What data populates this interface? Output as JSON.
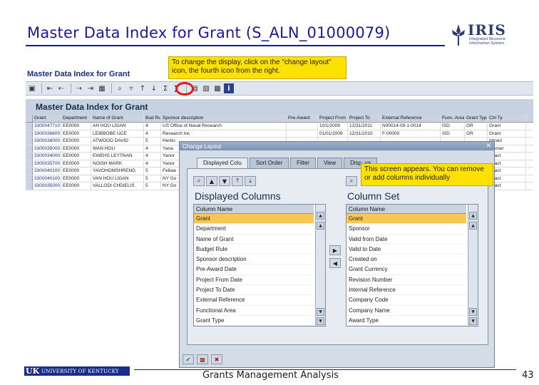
{
  "slide": {
    "title": "Master Data Index for Grant (S_ALN_01000079)",
    "footer_center": "Grants Management Analysis",
    "page_number": "43"
  },
  "logo": {
    "word": "IRIS",
    "sub": "Integrated Resource Information System"
  },
  "uk_logo": {
    "abbr": "UK",
    "name": "UNIVERSITY OF KENTUCKY"
  },
  "sap": {
    "window_title": "Master Data Index for Grant",
    "grid_title": "Master Data Index for Grant",
    "toolbar_icons": [
      "print-icon",
      "first-page-icon",
      "prev-page-icon",
      "next-page-icon",
      "last-page-icon",
      "filter-icon",
      "sort-asc-icon",
      "sort-desc-icon",
      "sum-icon",
      "subtotal-icon",
      "change-layout-icon",
      "select-layout-icon",
      "save-layout-icon",
      "info-icon"
    ]
  },
  "callouts": {
    "change_layout": "To change the display, click on the \"change layout\" icon, the fourth icon from the right.",
    "screen_appears": "This screen appears. You can remove or add columns individually"
  },
  "grid": {
    "columns": [
      "Grant",
      "Department",
      "Name of Grant",
      "Bud Rule",
      "Sponsor description",
      "Pre-Award",
      "Project From",
      "Project To",
      "External Reference",
      "Func. Area",
      "Grant Type",
      "Ctrl Ty"
    ],
    "rows": [
      [
        "3300047710",
        "EE0000",
        "AN HOU LIGAN",
        "4",
        "US Office of Naval Research",
        "",
        "10/1/2009",
        "12/31/2011",
        "N00014-09-1-0014",
        "ISD",
        "GR",
        "Grant"
      ],
      [
        "3300036800",
        "EE0000",
        "LEIBBOBE UCE",
        "4",
        "Research Inc",
        "",
        "01/01/2009",
        "12/31/2010",
        "F-00000",
        "ISD",
        "GR",
        "Grant"
      ],
      [
        "3300036000",
        "EE0000",
        "ATWOOD DAVID",
        "5",
        "Herbo",
        "",
        "",
        "",
        "",
        "",
        "",
        "mtract"
      ],
      [
        "3300035000",
        "EE0000",
        "WAN HOU",
        "4",
        "Yana",
        "",
        "",
        "",
        "",
        "",
        "",
        "reemer"
      ],
      [
        "3300034000",
        "EE0000",
        "EWEHS LEYTNAN",
        "4",
        "Yanor",
        "",
        "",
        "",
        "",
        "",
        "",
        "ntract"
      ],
      [
        "3300035700",
        "EE0000",
        "NOISH MARK",
        "4",
        "Yanor",
        "",
        "",
        "",
        "",
        "",
        "",
        "ntract"
      ],
      [
        "3300040100",
        "EE0000",
        "YAVOHOMSHRENG",
        "5",
        "Feliwa",
        "",
        "",
        "",
        "",
        "",
        "",
        "ntract"
      ],
      [
        "3300040100",
        "EE0000",
        "VAN HOU LIGAN",
        "5",
        "NY Go",
        "",
        "",
        "",
        "",
        "",
        "",
        "ntract"
      ],
      [
        "3300035000",
        "EE0000",
        "VALLODI CHDIELIS",
        "5",
        "NY Go",
        "",
        "",
        "",
        "",
        "",
        "",
        "ntract"
      ]
    ]
  },
  "dialog": {
    "title": "Change Layout",
    "tabs": [
      "Displayed Colu",
      "Sort Order",
      "Filter",
      "View",
      "Disp. va"
    ],
    "left": {
      "heading": "Displayed Columns",
      "column_header": "Column Name",
      "items": [
        "Grant",
        "Department",
        "Name of Grant",
        "Budget Rule",
        "Sponsor description",
        "Pre-Award Date",
        "Project From Date",
        "Project To Date",
        "External Reference",
        "Functional Area",
        "Grant Type"
      ],
      "selected_index": 0
    },
    "right": {
      "heading": "Column Set",
      "column_header": "Column Name",
      "items": [
        "Grant",
        "Sponsor",
        "Valid from Date",
        "Valid to Date",
        "Created on",
        "Grant Currency",
        "Revision Number",
        "Internal Reference",
        "Company Code",
        "Company Name",
        "Award Type"
      ],
      "selected_index": 0
    }
  }
}
